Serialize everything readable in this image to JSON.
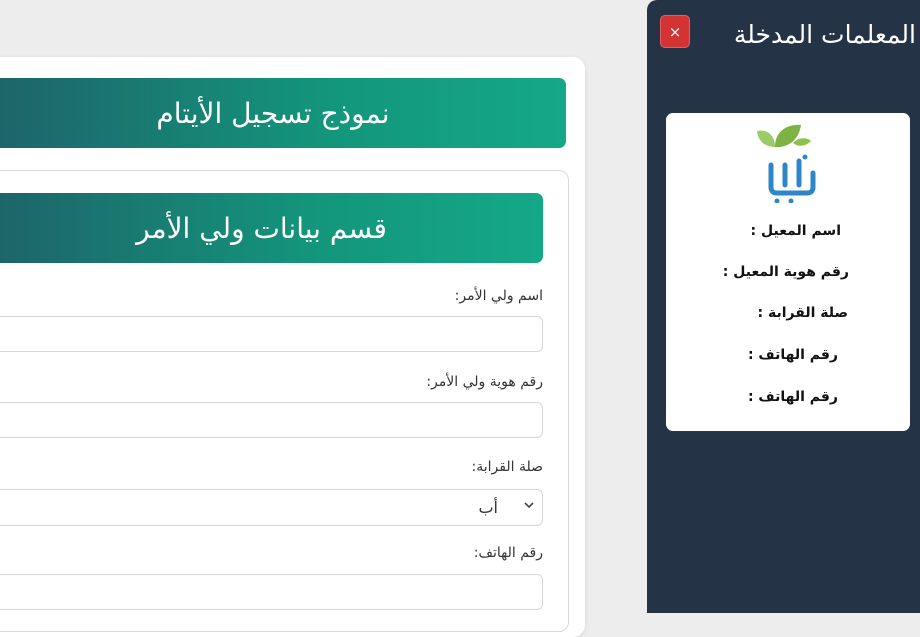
{
  "form": {
    "main_title": "نموذج تسجيل الأيتام",
    "section_title": "قسم بيانات ولي الأمر",
    "fields": [
      {
        "label": "اسم ولي الأمر:",
        "value": ""
      },
      {
        "label": "رقم هوية ولي الأمر:",
        "value": ""
      },
      {
        "label": "صلة القرابة:",
        "selected": "أب"
      },
      {
        "label": "رقم الهاتف:",
        "value": ""
      }
    ]
  },
  "side_panel": {
    "title": "المعلمات المدخلة",
    "close_label": "×",
    "info_lines": [
      "اسم المعيل :",
      "رقم هوية المعيل :",
      "صلة القرابة :",
      "رقم الهاتف :",
      "رقم الهاتف :"
    ]
  },
  "colors": {
    "panel_bg": "#243446",
    "banner_start": "#1e6268",
    "banner_end": "#14a888",
    "close_bg": "#d43333"
  },
  "icons": [
    "chevron-down-icon",
    "logo-leaf-icon"
  ]
}
